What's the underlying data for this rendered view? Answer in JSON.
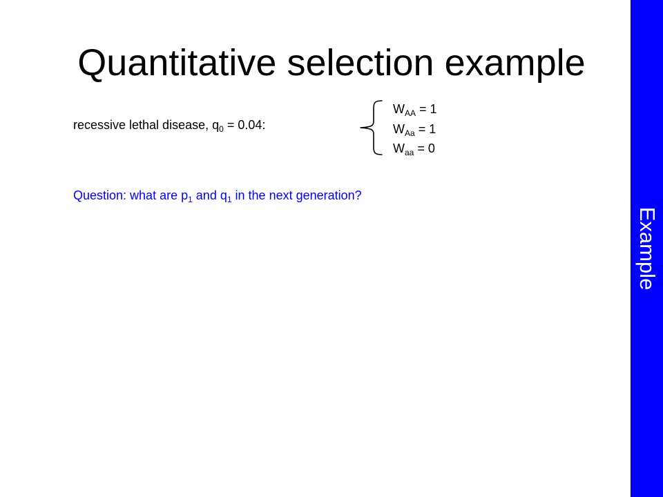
{
  "colors": {
    "background": "#ffffff",
    "text": "#000000",
    "question_text": "#0000ff",
    "sidebar_bg": "#0000ff",
    "sidebar_text": "#ffffff"
  },
  "slide": {
    "title": "Quantitative selection example",
    "problem": {
      "prefix": "recessive lethal disease, q",
      "sub": "0",
      "suffix": " = 0.04:"
    },
    "fitness": [
      {
        "symbol": "W",
        "sub": "AA",
        "rest": " = 1"
      },
      {
        "symbol": "W",
        "sub": "Aa",
        "rest": " = 1"
      },
      {
        "symbol": "W",
        "sub": "aa",
        "rest": " = 0"
      }
    ],
    "question": {
      "part1": "Question:  what are p",
      "sub1": "1",
      "part2": " and q",
      "sub2": "1",
      "part3": " in the next generation?"
    },
    "sidebar_label": "Example"
  }
}
